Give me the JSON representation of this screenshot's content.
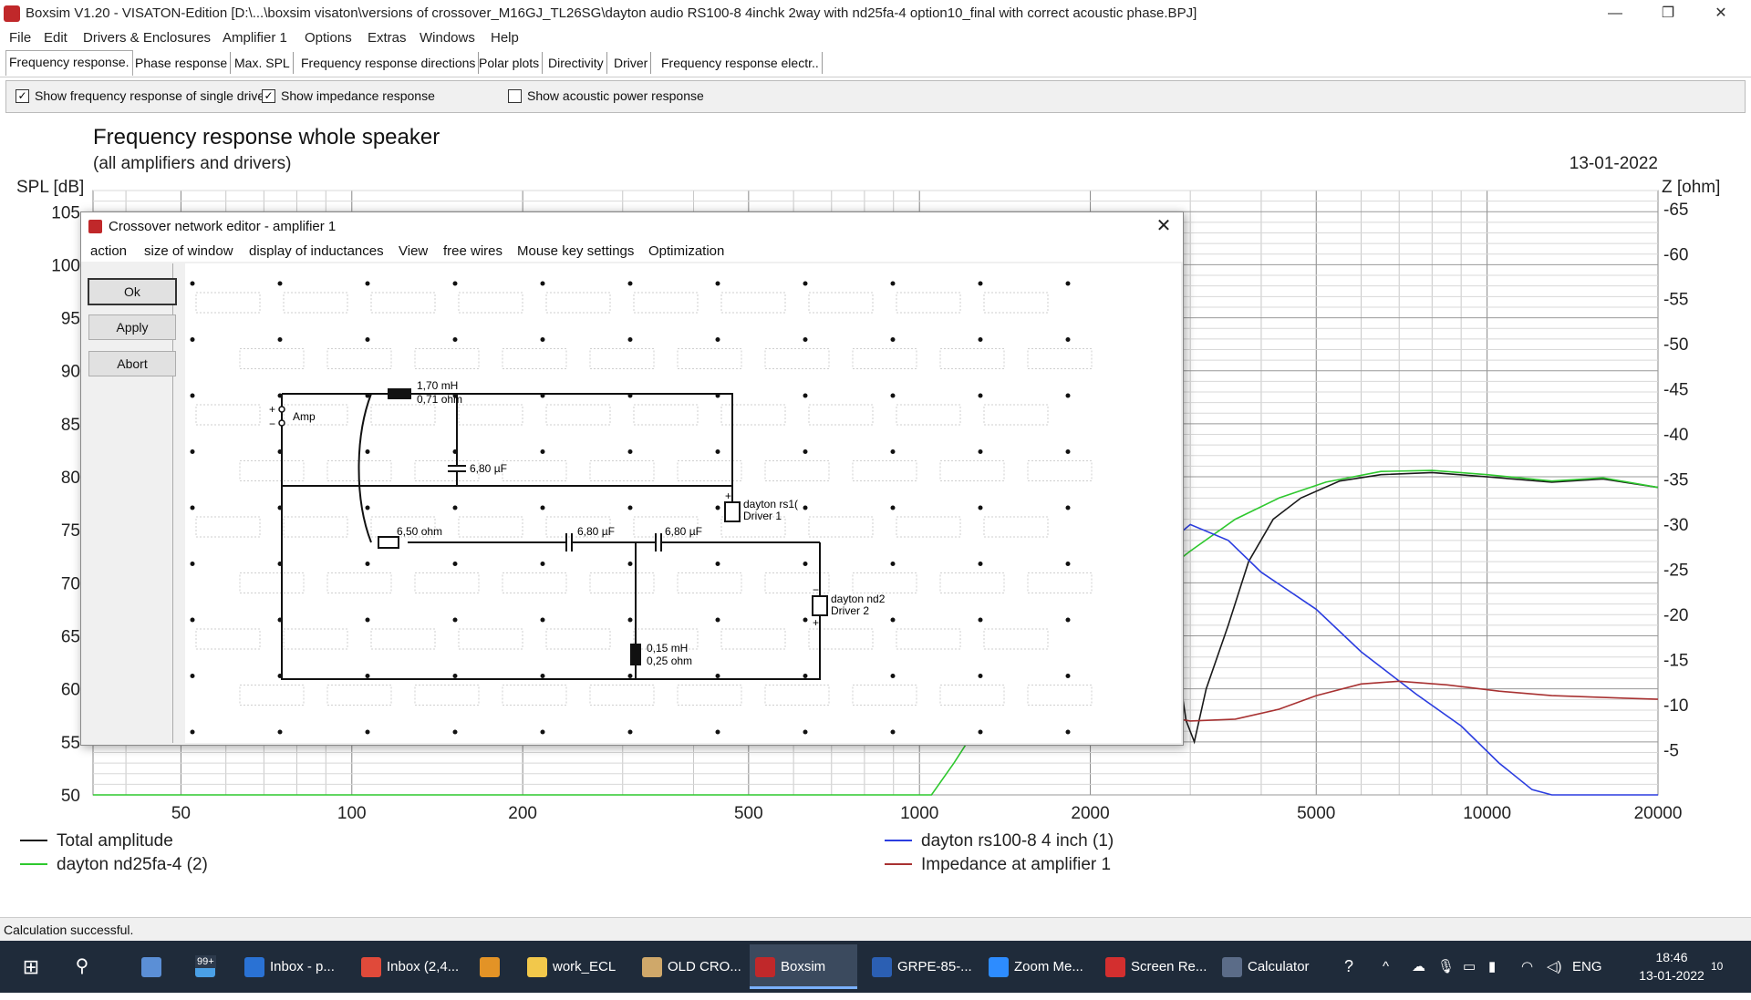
{
  "window": {
    "title": "Boxsim V1.20 - VISATON-Edition [D:\\...\\boxsim visaton\\versions of crossover_M16GJ_TL26SG\\dayton audio RS100-8  4inchk 2way with nd25fa-4 option10_final with correct acoustic phase.BPJ]",
    "minimize": "—",
    "restore": "❐",
    "close": "✕"
  },
  "menu": [
    "File",
    "Edit",
    "Drivers & Enclosures",
    "Amplifier 1",
    "Options",
    "Extras",
    "Windows",
    "Help"
  ],
  "tabs": [
    {
      "label": "Frequency response."
    },
    {
      "label": "Phase response"
    },
    {
      "label": "Max. SPL"
    },
    {
      "label": "Frequency response directions"
    },
    {
      "label": "Polar plots"
    },
    {
      "label": "Directivity"
    },
    {
      "label": "Driver"
    },
    {
      "label": "Frequency response electr.."
    }
  ],
  "options": {
    "single_drive": {
      "label": "Show frequency response of single drive",
      "checked": true,
      "mark": "✓"
    },
    "impedance": {
      "label": "Show impedance response",
      "checked": true,
      "mark": "✓"
    },
    "acoustic_power": {
      "label": "Show acoustic power response",
      "checked": false,
      "mark": ""
    }
  },
  "chart_data": {
    "type": "line",
    "title": "Frequency response whole speaker",
    "subtitle": "(all amplifiers and drivers)",
    "date": "13-01-2022",
    "ylabel": "SPL [dB]",
    "y2label": "Z [ohm]",
    "xscale": "log",
    "xlim": [
      35,
      20000
    ],
    "ylim": [
      50,
      107
    ],
    "y2lim": [
      0,
      67
    ],
    "xticks": [
      50,
      100,
      200,
      500,
      1000,
      2000,
      5000,
      10000,
      20000
    ],
    "yticks": [
      50,
      55,
      60,
      65,
      70,
      75,
      80,
      85,
      90,
      95,
      100,
      105
    ],
    "y2ticks": [
      5,
      10,
      15,
      20,
      25,
      30,
      35,
      40,
      45,
      50,
      55,
      60,
      65
    ],
    "legend_placement": "bottom",
    "series": [
      {
        "name": "Total amplitude",
        "color": "#1a1a1a",
        "axis": "left",
        "points": [
          [
            2600,
            73
          ],
          [
            2800,
            65
          ],
          [
            2950,
            57
          ],
          [
            3050,
            55
          ],
          [
            3200,
            60
          ],
          [
            3500,
            66
          ],
          [
            3800,
            72
          ],
          [
            4200,
            76
          ],
          [
            4700,
            78
          ],
          [
            5500,
            79.6
          ],
          [
            6500,
            80.2
          ],
          [
            8000,
            80.4
          ],
          [
            10000,
            80
          ],
          [
            13000,
            79.5
          ],
          [
            16000,
            79.8
          ],
          [
            20000,
            79
          ]
        ]
      },
      {
        "name": "dayton nd25fa-4 (2)",
        "color": "#2ec82e",
        "axis": "left",
        "points": [
          [
            35,
            50
          ],
          [
            1050,
            50
          ],
          [
            1150,
            53
          ],
          [
            1250,
            56
          ],
          [
            1500,
            60
          ],
          [
            1900,
            64
          ],
          [
            2400,
            69
          ],
          [
            3000,
            73
          ],
          [
            3600,
            76
          ],
          [
            4300,
            78
          ],
          [
            5200,
            79.5
          ],
          [
            6500,
            80.5
          ],
          [
            8000,
            80.6
          ],
          [
            10000,
            80.2
          ],
          [
            13000,
            79.6
          ],
          [
            16000,
            79.9
          ],
          [
            20000,
            79
          ]
        ]
      },
      {
        "name": "dayton rs100-8 4 inch (1)",
        "color": "#2b3de0",
        "axis": "left",
        "points": [
          [
            2500,
            72
          ],
          [
            3000,
            75.5
          ],
          [
            3500,
            74
          ],
          [
            4000,
            71
          ],
          [
            5000,
            67.5
          ],
          [
            6000,
            63.5
          ],
          [
            7500,
            59.5
          ],
          [
            9000,
            56.5
          ],
          [
            10500,
            53
          ],
          [
            12000,
            50.5
          ],
          [
            13000,
            50
          ],
          [
            20000,
            50
          ]
        ]
      },
      {
        "name": "Impedance at amplifier 1",
        "color": "#a83232",
        "axis": "right",
        "points": [
          [
            2500,
            9
          ],
          [
            3000,
            8.2
          ],
          [
            3600,
            8.4
          ],
          [
            4300,
            9.5
          ],
          [
            5000,
            11
          ],
          [
            6000,
            12.3
          ],
          [
            7000,
            12.6
          ],
          [
            8500,
            12.2
          ],
          [
            10500,
            11.5
          ],
          [
            13000,
            11
          ],
          [
            16000,
            10.8
          ],
          [
            20000,
            10.6
          ]
        ]
      }
    ]
  },
  "dialog": {
    "title": "Crossover network editor - amplifier 1",
    "close": "✕",
    "menu": [
      "action",
      "size of window",
      "display of inductances",
      "View",
      "free wires",
      "Mouse key settings",
      "Optimization"
    ],
    "buttons": {
      "ok": "Ok",
      "apply": "Apply",
      "abort": "Abort"
    },
    "circuit": {
      "amp_label": "Amp",
      "plus": "+",
      "minus": "−",
      "l1_value": "1,70 mH",
      "l1_res": "0,71 ohm",
      "c1_value": "6,80 µF",
      "driver1_name": "dayton rs1(",
      "driver1_label": "Driver 1",
      "r1_value": "6,50 ohm",
      "c2_value": "6,80 µF",
      "c3_value": "6,80 µF",
      "l2_value": "0,15 mH",
      "l2_res": "0,25 ohm",
      "driver2_name": "dayton nd2",
      "driver2_label": "Driver 2"
    }
  },
  "status": {
    "text": "Calculation successful."
  },
  "taskbar": {
    "badge": "99+",
    "items": [
      {
        "label": "Inbox - p...",
        "color": "#2a72d4"
      },
      {
        "label": "Inbox (2,4...",
        "color": "#e04a3a"
      },
      {
        "label": "",
        "color": "#e39326"
      },
      {
        "label": "work_ECL",
        "color": "#f2c84b"
      },
      {
        "label": "OLD CRO...",
        "color": "#cfa86a"
      },
      {
        "label": "Boxsim",
        "color": "#c0282a"
      },
      {
        "label": "GRPE-85-...",
        "color": "#2b5fb3"
      },
      {
        "label": "Zoom Me...",
        "color": "#2d8cff"
      },
      {
        "label": "Screen Re...",
        "color": "#d32f2f"
      },
      {
        "label": "Calculator",
        "color": "#5b6c88"
      }
    ],
    "help": "?",
    "chevron": "^",
    "lang": "ENG",
    "time": "18:46",
    "date": "13-01-2022",
    "notif": "10"
  }
}
